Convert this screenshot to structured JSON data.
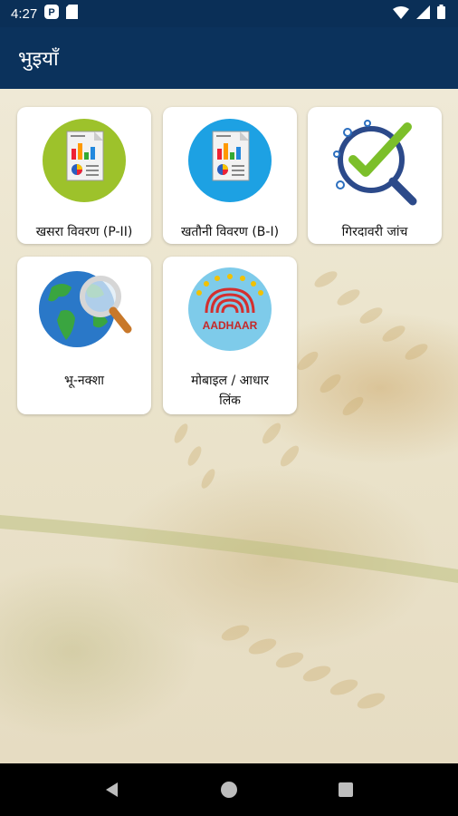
{
  "status_bar": {
    "time": "4:27",
    "icons_left": [
      "blogger-icon",
      "sd-card-icon"
    ],
    "icons_right": [
      "wifi-icon",
      "signal-icon",
      "battery-icon"
    ]
  },
  "app_bar": {
    "title": "भुइयाँ"
  },
  "tiles": [
    {
      "label": "खसरा विवरण (P-II)",
      "icon": "report-icon",
      "color": "#9dc22b"
    },
    {
      "label": "खतौनी विवरण (B-I)",
      "icon": "report-icon",
      "color": "#1da1e3"
    },
    {
      "label": "गिरदावरी जांच",
      "icon": "verify-check-icon",
      "color": "#2c4a8a"
    },
    {
      "label": "भू-नक्शा",
      "icon": "globe-search-icon",
      "color": "#2a78c8"
    },
    {
      "label_line1": "मोबाइल / आधार",
      "label_line2": "लिंक",
      "icon": "aadhaar-icon",
      "color": "#f2c100",
      "logo_text": "AADHAAR"
    }
  ],
  "nav_bar": {
    "buttons": [
      "back-button",
      "home-button",
      "recents-button"
    ]
  }
}
